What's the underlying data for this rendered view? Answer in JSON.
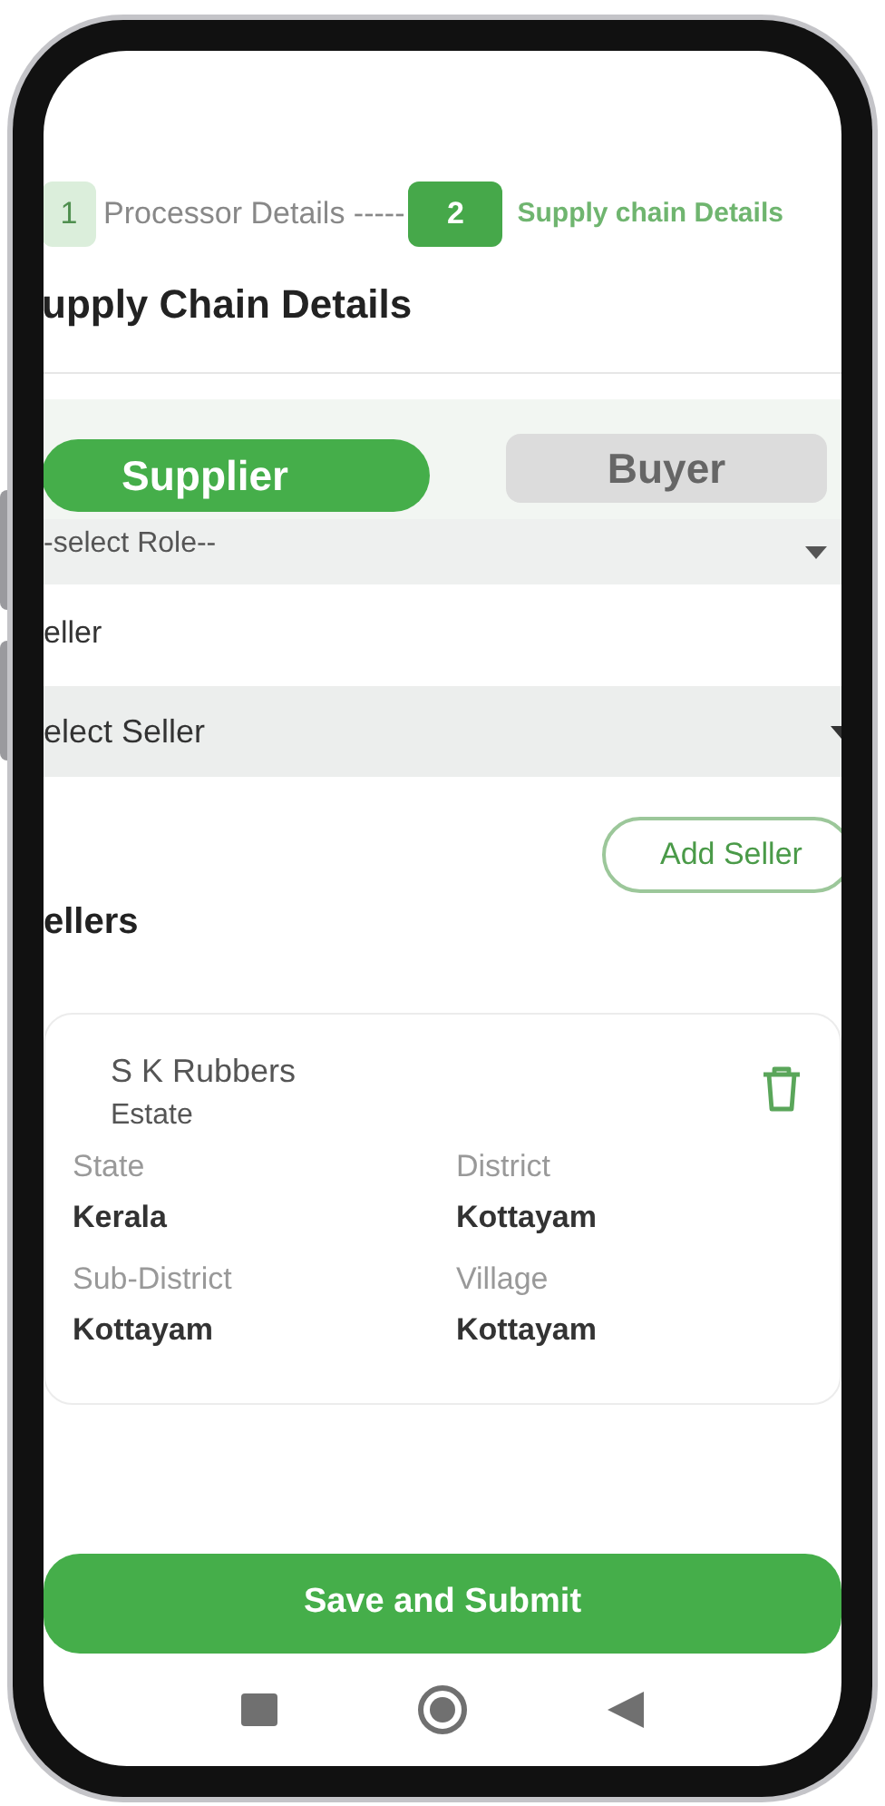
{
  "stepper": [
    {
      "number": "1",
      "label": "Processor Details -----",
      "current": false
    },
    {
      "number": "2",
      "label": "Supply chain Details",
      "current": true
    }
  ],
  "heading": "upply Chain Details",
  "roles": [
    {
      "label": "Supplier",
      "selected": true
    },
    {
      "label": "Buyer",
      "selected": false
    }
  ],
  "role_select": {
    "value": "-select Role--"
  },
  "seller_label": "eller",
  "seller_select": {
    "value": "elect Seller"
  },
  "add_button": "Add Seller",
  "sellers_heading": "ellers",
  "sellers": [
    {
      "name": "S K Rubbers",
      "type": "Estate",
      "fields": [
        {
          "label": "State",
          "value": "Kerala"
        },
        {
          "label": "District",
          "value": "Kottayam"
        },
        {
          "label": "Sub-District",
          "value": "Kottayam"
        },
        {
          "label": "Village",
          "value": "Kottayam"
        }
      ]
    }
  ],
  "submit_button": "Save and Submit"
}
